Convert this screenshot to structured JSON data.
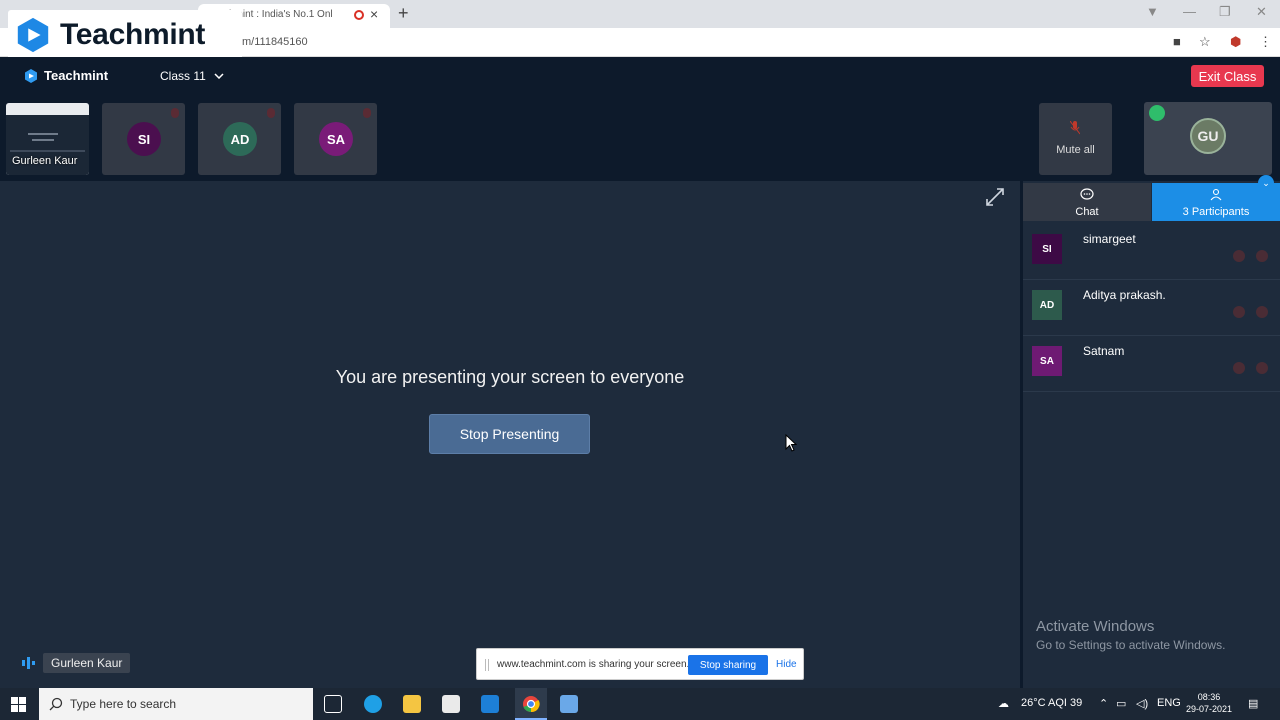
{
  "browser": {
    "tab_title": "chmint : India's No.1 Onl",
    "url": "m/111845160"
  },
  "logo_overlay": {
    "text": "Teachmint"
  },
  "app": {
    "brand": "Teachmint",
    "class_name": "Class 11",
    "exit_label": "Exit Class"
  },
  "tiles": [
    {
      "initials": "SI",
      "color": "#4b0f4f"
    },
    {
      "initials": "AD",
      "color": "#2d6a58"
    },
    {
      "initials": "SA",
      "color": "#7a1b78"
    }
  ],
  "screen_tile": {
    "name": "Gurleen Kaur"
  },
  "mute_all": {
    "label": "Mute all"
  },
  "self_tile": {
    "initials": "GU"
  },
  "stage": {
    "message": "You are presenting your screen to everyone",
    "stop_label": "Stop Presenting",
    "presenter_name": "Gurleen Kaur"
  },
  "panel": {
    "chat_label": "Chat",
    "participants_label": "3 Participants",
    "participants": [
      {
        "initials": "SI",
        "name": "simargeet",
        "color": "#3d0a45"
      },
      {
        "initials": "AD",
        "name": "Aditya prakash.",
        "color": "#2d5a4c"
      },
      {
        "initials": "SA",
        "name": "Satnam",
        "color": "#6e1a73"
      }
    ]
  },
  "watermark": {
    "line1": "Activate Windows",
    "line2": "Go to Settings to activate Windows."
  },
  "share_bar": {
    "message": "www.teachmint.com is sharing your screen.",
    "stop_label": "Stop sharing",
    "hide_label": "Hide"
  },
  "taskbar": {
    "search_placeholder": "Type here to search",
    "weather": "26°C  AQI 39",
    "language": "ENG",
    "time": "08:36",
    "date": "29-07-2021"
  },
  "colors": {
    "accent": "#1c8ee6",
    "exit": "#e8384f",
    "app_bg": "#0d1a2b",
    "stage_bg": "#1e2b3c"
  }
}
